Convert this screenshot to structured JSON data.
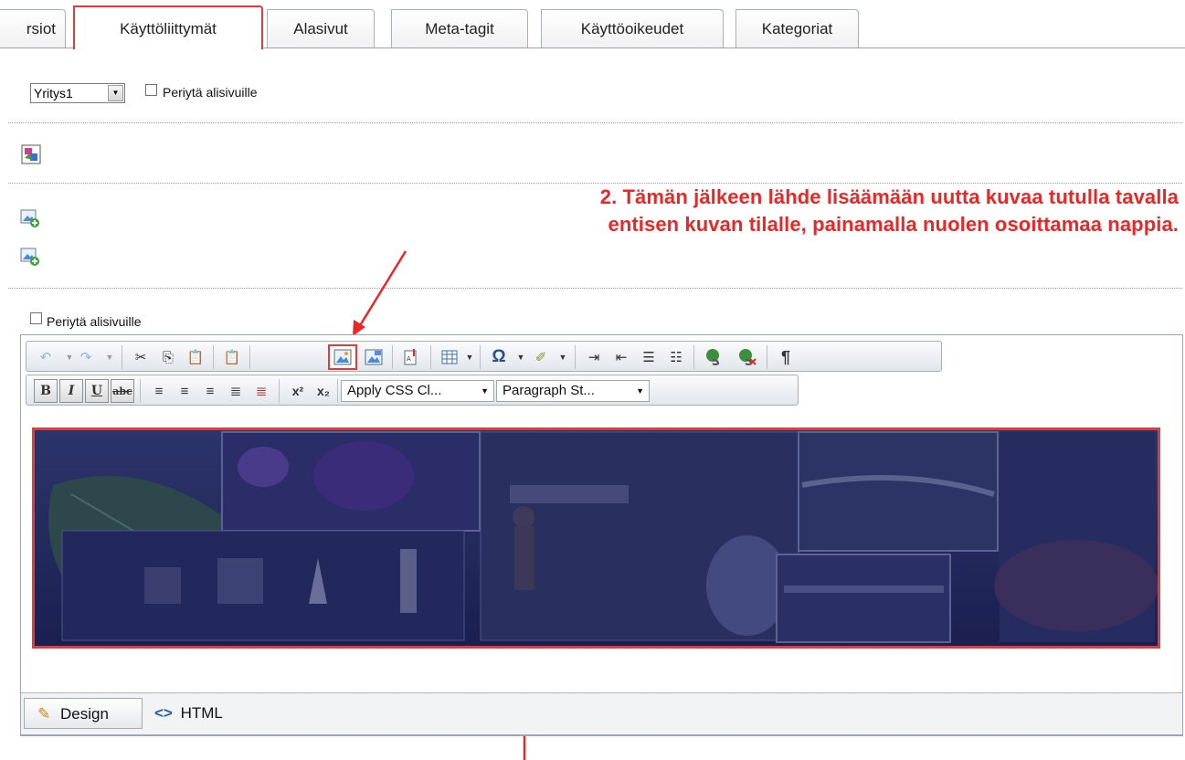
{
  "tabs": [
    {
      "label": "rsiot"
    },
    {
      "label": "Käyttöliittymät"
    },
    {
      "label": "Alasivut"
    },
    {
      "label": "Meta-tagit"
    },
    {
      "label": "Käyttöoikeudet"
    },
    {
      "label": "Kategoriat"
    }
  ],
  "top_controls": {
    "select_value": "Yritys1",
    "inherit_label": "Periytä alisivuille"
  },
  "annotation": {
    "line1": "2. Tämän jälkeen lähde lisäämään uutta kuvaa tutulla tavalla",
    "line2": "entisen kuvan tilalle, painamalla nuolen osoittamaa nappia."
  },
  "editor": {
    "inherit_label": "Periytä alisivuille",
    "css_class_dropdown": "Apply CSS Cl...",
    "paragraph_dropdown": "Paragraph St...",
    "format_buttons": {
      "bold": "B",
      "italic": "I",
      "underline": "U",
      "strike": "abc"
    },
    "superscript": "x²",
    "subscript": "x₂",
    "omega": "Ω",
    "pilcrow": "¶"
  },
  "bottom_tabs": {
    "design": "Design",
    "html": "HTML"
  },
  "colors": {
    "highlight": "#e23b3b",
    "annotation": "#ea2727"
  }
}
